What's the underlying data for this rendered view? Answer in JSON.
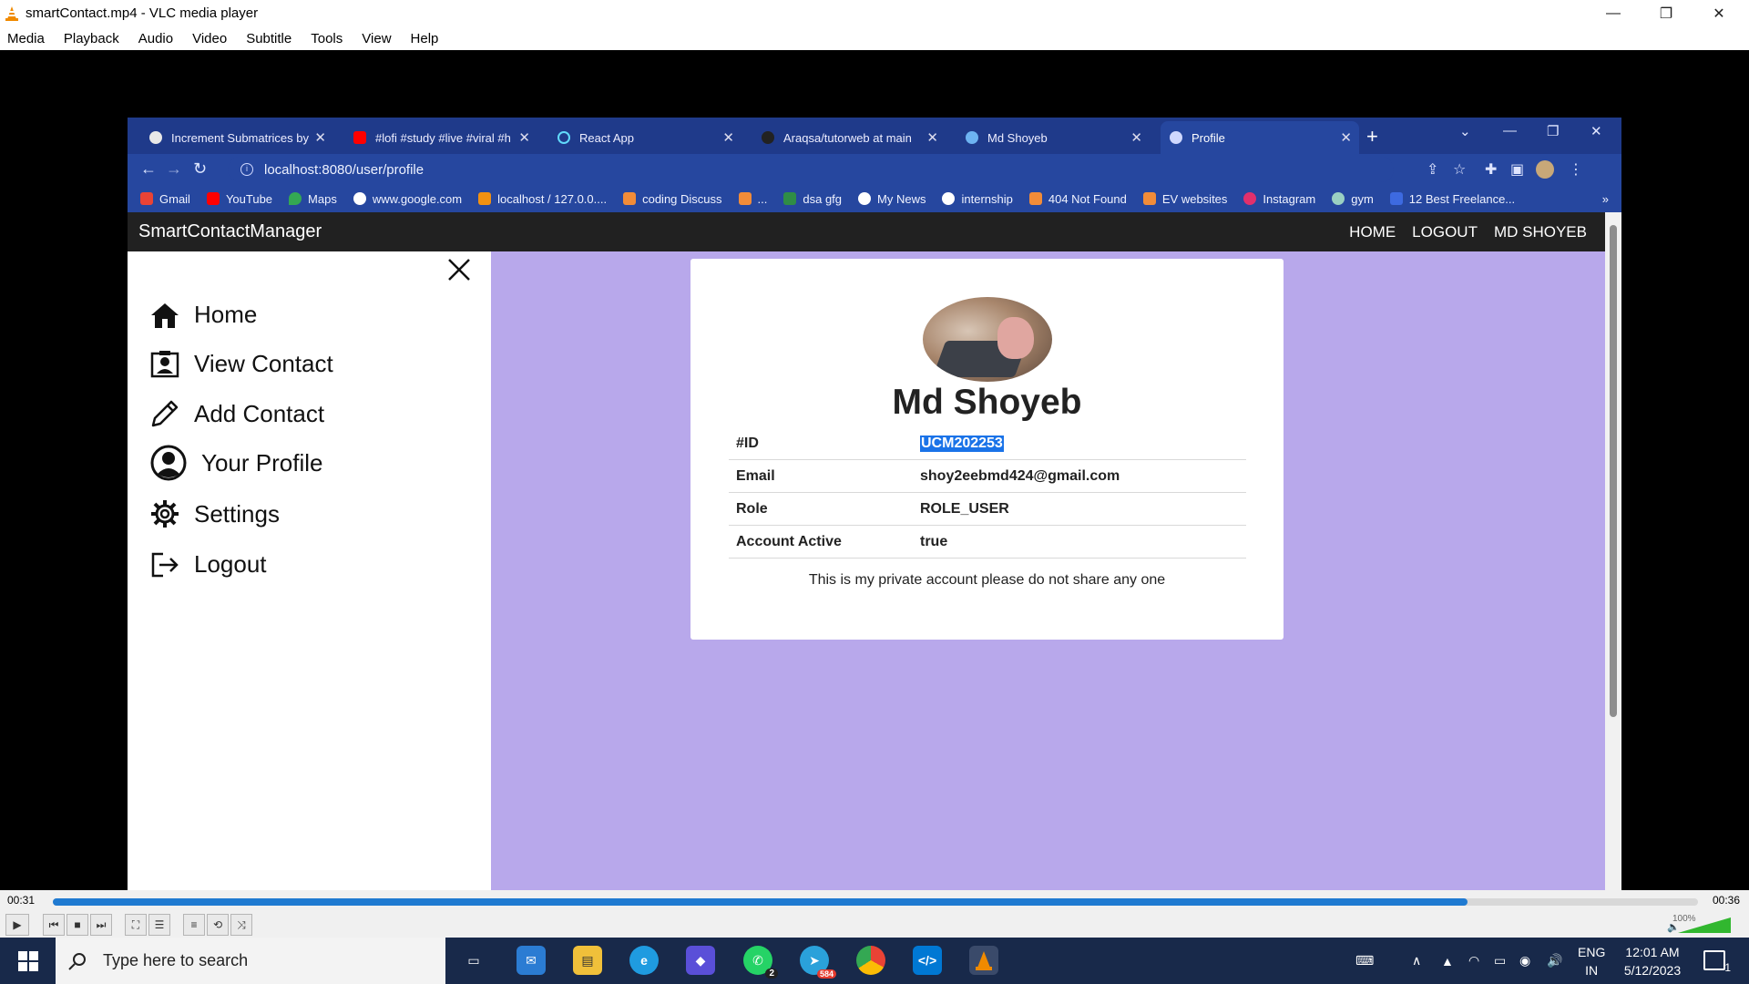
{
  "vlc": {
    "title": "smartContact.mp4 - VLC media player",
    "menu": [
      "Media",
      "Playback",
      "Audio",
      "Video",
      "Subtitle",
      "Tools",
      "View",
      "Help"
    ],
    "time_elapsed": "00:31",
    "time_total": "00:36",
    "progress_fraction": 0.86,
    "volume_label": "100%"
  },
  "browser": {
    "tabs": [
      {
        "label": "Increment Submatrices by",
        "icon_color": "#e8e8e8"
      },
      {
        "label": "#lofi #study #live #viral #h",
        "icon_color": "#ff0000"
      },
      {
        "label": "React App",
        "icon_color": "#61dafb"
      },
      {
        "label": "Araqsa/tutorweb at main",
        "icon_color": "#222222"
      },
      {
        "label": "Md Shoyeb",
        "icon_color": "#6db3f2"
      },
      {
        "label": "Profile",
        "icon_color": "#cfd8ff"
      }
    ],
    "url": "localhost:8080/user/profile",
    "bookmarks": [
      {
        "label": "Gmail",
        "color": "#ea4335"
      },
      {
        "label": "YouTube",
        "color": "#ff0000"
      },
      {
        "label": "Maps",
        "color": "#34a853"
      },
      {
        "label": "www.google.com",
        "color": "#ffffff"
      },
      {
        "label": "localhost / 127.0.0....",
        "color": "#f29111"
      },
      {
        "label": "coding Discuss",
        "color": "#f28c38"
      },
      {
        "label": "...",
        "color": "#f28c38"
      },
      {
        "label": "dsa gfg",
        "color": "#2f8d46"
      },
      {
        "label": "My News",
        "color": "#ffffff"
      },
      {
        "label": "internship",
        "color": "#ffffff"
      },
      {
        "label": "404 Not Found",
        "color": "#f28c38"
      },
      {
        "label": "EV websites",
        "color": "#f28c38"
      },
      {
        "label": "Instagram",
        "color": "#e1306c"
      },
      {
        "label": "gym",
        "color": "#9ad0c2"
      },
      {
        "label": "12 Best Freelance...",
        "color": "#3d6ae0"
      }
    ]
  },
  "site": {
    "brand": "SmartContactManager",
    "nav_links": [
      "HOME",
      "LOGOUT",
      "MD SHOYEB"
    ],
    "sidebar": [
      {
        "label": "Home",
        "icon": "home-icon"
      },
      {
        "label": "View Contact",
        "icon": "contact-card-icon"
      },
      {
        "label": "Add Contact",
        "icon": "pencil-icon"
      },
      {
        "label": "Your Profile",
        "icon": "user-circle-icon"
      },
      {
        "label": "Settings",
        "icon": "gear-icon"
      },
      {
        "label": "Logout",
        "icon": "logout-icon"
      }
    ],
    "profile": {
      "name": "Md Shoyeb",
      "rows": [
        {
          "key": "#ID",
          "value": "UCM202253"
        },
        {
          "key": "Email",
          "value": "shoy2eebmd424@gmail.com"
        },
        {
          "key": "Role",
          "value": "ROLE_USER"
        },
        {
          "key": "Account Active",
          "value": "true"
        }
      ],
      "note": "This is my private account please do not share any one"
    },
    "page_bg": "#b8a8eb"
  },
  "taskbar": {
    "search_placeholder": "Type here to search",
    "whatsapp_badge": "2",
    "telegram_badge": "584",
    "lang": "ENG",
    "region": "IN",
    "time": "12:01 AM",
    "date": "5/12/2023",
    "notification_count": "1"
  }
}
